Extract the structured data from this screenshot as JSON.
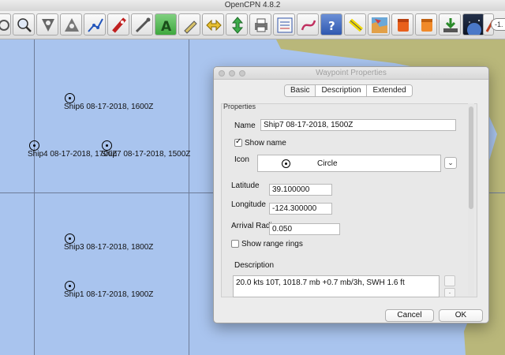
{
  "app": {
    "title": "OpenCPN 4.8.2"
  },
  "toolbar": {
    "tools": [
      "settings-icon",
      "zoom-icon",
      "tide-icon",
      "current-icon",
      "route-icon",
      "track-icon",
      "waypoint-tool-icon",
      "text-tool-icon",
      "mark-tool-icon",
      "swap-icon",
      "arrows-icon",
      "print-icon",
      "route-manager-icon",
      "curve-icon",
      "help-icon",
      "highlighter-icon",
      "map-icon",
      "bucket-red-icon",
      "bucket-orange-icon",
      "download-icon",
      "globe-icon",
      "edit-icon",
      "chart-icon"
    ],
    "zoom_label": "-1."
  },
  "chart": {
    "waypoints": [
      {
        "id": "ship6",
        "label": "Ship6 08-17-2018, 1600Z"
      },
      {
        "id": "ship4",
        "label": "Ship4 08-17-2018, 1700Z"
      },
      {
        "id": "ship7",
        "label": "Ship7 08-17-2018, 1500Z"
      },
      {
        "id": "ship3",
        "label": "Ship3 08-17-2018, 1800Z"
      },
      {
        "id": "ship1",
        "label": "Ship1 08-17-2018, 1900Z"
      }
    ]
  },
  "dialog": {
    "title": "Waypoint Properties",
    "tabs": [
      {
        "label": "Basic",
        "active": true
      },
      {
        "label": "Description",
        "active": false
      },
      {
        "label": "Extended",
        "active": false
      }
    ],
    "section_title": "Properties",
    "name_label": "Name",
    "name_value": "Ship7 08-17-2018, 1500Z",
    "show_name_label": "Show name",
    "show_name_checked": true,
    "icon_label": "Icon",
    "icon_value": "Circle",
    "latitude_label": "Latitude",
    "latitude_value": "39.100000",
    "longitude_label": "Longitude",
    "longitude_value": "-124.300000",
    "arrival_radius_label": "Arrival Radius",
    "arrival_radius_value": "0.050",
    "show_range_rings_label": "Show range rings",
    "show_range_rings_checked": false,
    "description_label": "Description",
    "description_value": "20.0 kts 10T, 1018.7 mb +0.7 mb/3h, SWH 1.6 ft",
    "desc_side_button_label": ".",
    "cancel_label": "Cancel",
    "ok_label": "OK"
  },
  "colors": {
    "water": "#a9c4ee",
    "land": "#b9b77a",
    "grid": "#6e7c99"
  }
}
